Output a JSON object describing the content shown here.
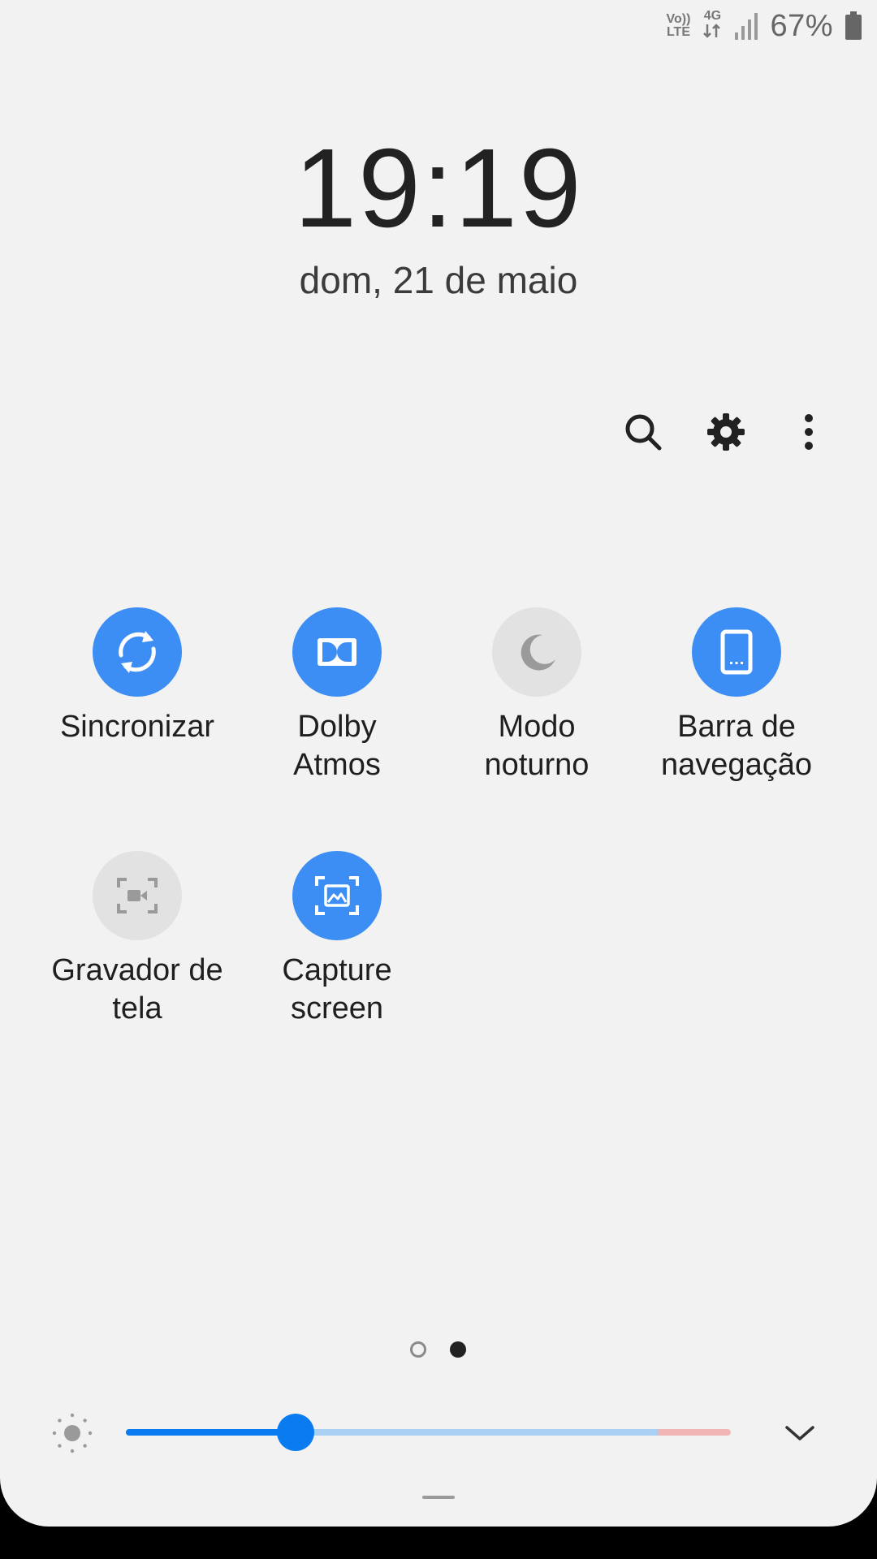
{
  "status_bar": {
    "volte_top": "Vo))",
    "volte_bottom": "LTE",
    "network_type": "4G",
    "battery_percent": "67%",
    "icons": [
      "volte-icon",
      "4g-data-icon",
      "signal-icon",
      "battery-icon"
    ]
  },
  "clock": {
    "time": "19:19",
    "date": "dom, 21 de maio"
  },
  "header_actions": [
    {
      "name": "search-icon"
    },
    {
      "name": "settings-gear-icon"
    },
    {
      "name": "more-options-icon"
    }
  ],
  "tiles": [
    {
      "label": "Sincronizar",
      "icon": "sync-icon",
      "active": true
    },
    {
      "label": "Dolby\nAtmos",
      "icon": "dolby-icon",
      "active": true
    },
    {
      "label": "Modo\nnoturno",
      "icon": "moon-icon",
      "active": false
    },
    {
      "label": "Barra de\nnavegação",
      "icon": "navigation-bar-icon",
      "active": true
    },
    {
      "label": "Gravador de\ntela",
      "icon": "screen-recorder-icon",
      "active": false
    },
    {
      "label": "Capture\nscreen",
      "icon": "capture-screen-icon",
      "active": true
    }
  ],
  "pagination": {
    "total": 2,
    "current": 2
  },
  "brightness": {
    "level": 0.28
  },
  "colors": {
    "accent": "#3d8ef4",
    "slider": "#0a7cf0",
    "tile_off": "#e2e2e3",
    "background": "#f2f2f3"
  }
}
